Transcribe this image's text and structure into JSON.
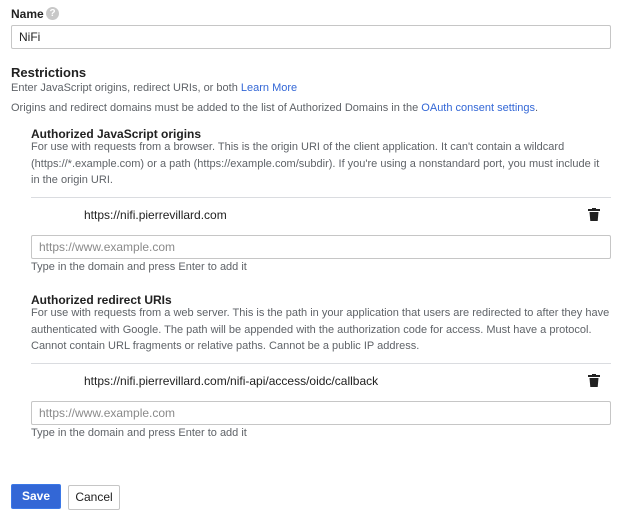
{
  "name_field": {
    "label": "Name",
    "help_icon": "help-circle-icon",
    "value": "NiFi"
  },
  "restrictions": {
    "title": "Restrictions",
    "intro_text": "Enter JavaScript origins, redirect URIs, or both",
    "learn_more": "Learn More",
    "domains_text": "Origins and redirect domains must be added to the list of Authorized Domains in the",
    "consent_link": "OAuth consent settings",
    "domains_period": "."
  },
  "js_origins": {
    "title": "Authorized JavaScript origins",
    "description": [
      "For use with requests from a browser. This is the origin URI of the client application. It can't contain a wildcard",
      "(https://*.example.com) or a path (https://example.com/subdir). If you're using a nonstandard port, you must include it",
      "in the origin URI."
    ],
    "entry": "https://nifi.pierrevillard.com",
    "placeholder": "https://www.example.com",
    "hint": "Type in the domain and press Enter to add it"
  },
  "redirect_uris": {
    "title": "Authorized redirect URIs",
    "description": [
      "For use with requests from a web server. This is the path in your application that users are redirected to after they have",
      "authenticated with Google. The path will be appended with the authorization code for access. Must have a protocol.",
      "Cannot contain URL fragments or relative paths. Cannot be a public IP address."
    ],
    "entry": "https://nifi.pierrevillard.com/nifi-api/access/oidc/callback",
    "placeholder": "https://www.example.com",
    "hint": "Type in the domain and press Enter to add it"
  },
  "actions": {
    "save": "Save",
    "cancel": "Cancel"
  },
  "icons": {
    "delete": "trash-icon"
  },
  "colors": {
    "primary": "#3367d6",
    "link": "#3367d6"
  }
}
